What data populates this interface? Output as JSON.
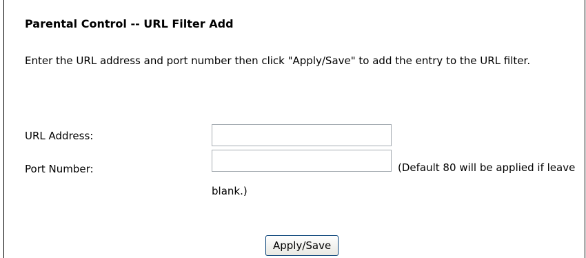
{
  "page": {
    "title": "Parental Control -- URL Filter Add",
    "instructions": "Enter the URL address and port number then click \"Apply/Save\" to add the entry to the URL filter."
  },
  "form": {
    "url_label": "URL Address:",
    "url_value": "",
    "port_label": "Port Number:",
    "port_value": "",
    "port_note": "(Default 80 will be applied if leave blank.)",
    "apply_label": "Apply/Save"
  }
}
